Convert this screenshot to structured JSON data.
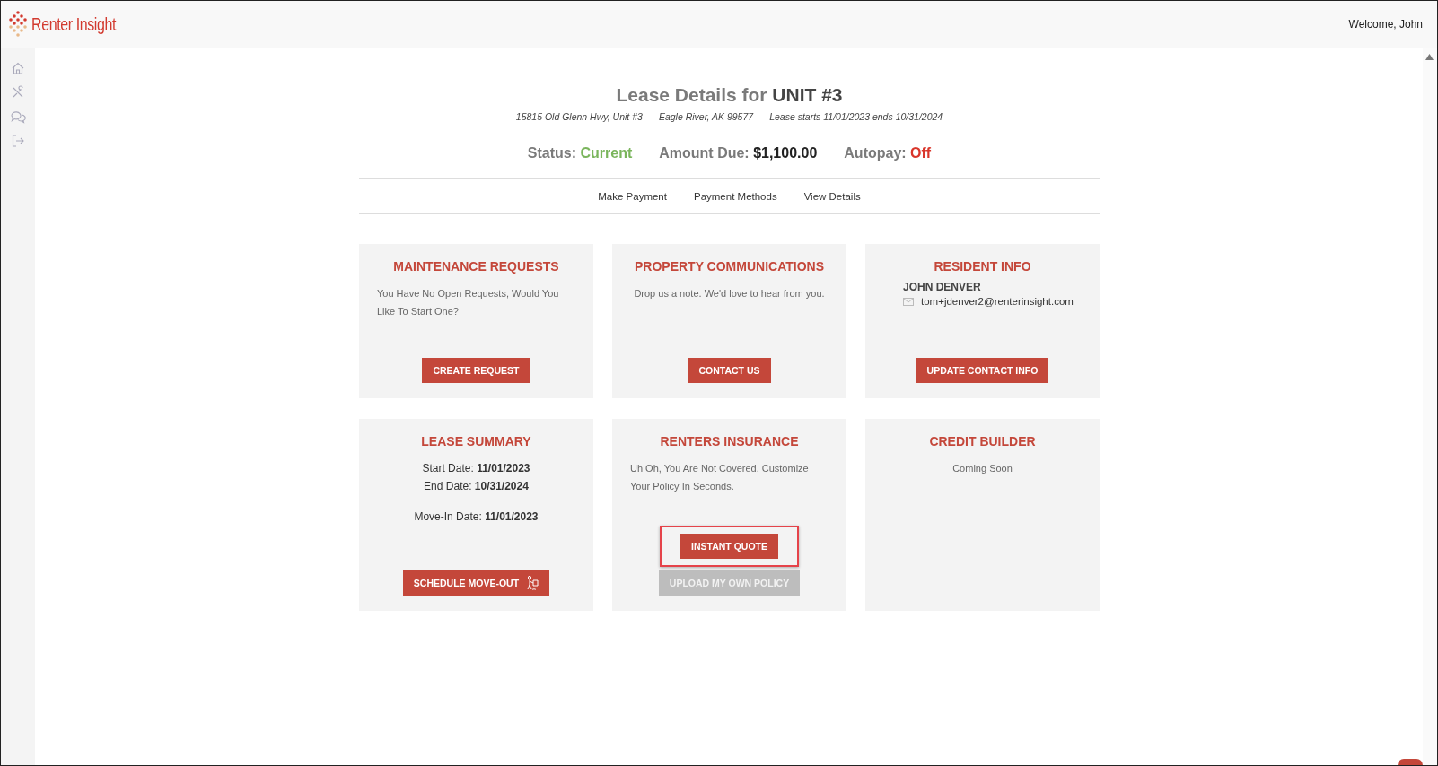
{
  "header": {
    "logo_text": "Renter Insight",
    "welcome": "Welcome, John"
  },
  "lease": {
    "title_prefix": "Lease Details for",
    "unit": "UNIT #3",
    "address": "15815 Old Glenn Hwy, Unit #3",
    "city": "Eagle River, AK 99577",
    "term": "Lease starts 11/01/2023 ends 10/31/2024"
  },
  "summary": [
    {
      "label": "Status:",
      "value": "Current",
      "color": "#7ab55c"
    },
    {
      "label": "Amount Due:",
      "value": "$1,100.00",
      "color": "#222222"
    },
    {
      "label": "Autopay:",
      "value": "Off",
      "color": "#d9362b"
    }
  ],
  "nav": [
    "Make Payment",
    "Payment Methods",
    "View Details"
  ],
  "cards": [
    {
      "kind": "text",
      "title": "MAINTENANCE REQUESTS",
      "text": "You Have No Open Requests, Would You Like To Start One?",
      "buttons": [
        {
          "label": "CREATE REQUEST",
          "disabled": false,
          "highlighted": false
        }
      ]
    },
    {
      "kind": "note",
      "title": "PROPERTY COMMUNICATIONS",
      "text": "Drop us a note. We'd love to hear from you.",
      "buttons": [
        {
          "label": "CONTACT US",
          "disabled": false,
          "highlighted": false
        }
      ]
    },
    {
      "kind": "resident",
      "title": "RESIDENT INFO",
      "name": "JOHN DENVER",
      "email": "tom+jdenver2@renterinsight.com",
      "buttons": [
        {
          "label": "UPDATE CONTACT INFO",
          "disabled": false,
          "highlighted": false
        }
      ]
    },
    {
      "kind": "dates",
      "title": "LEASE SUMMARY",
      "groups": [
        [
          {
            "label": "Start Date:",
            "value": "11/01/2023"
          },
          {
            "label": "End Date:",
            "value": "10/31/2024"
          }
        ],
        [
          {
            "label": "Move-In Date:",
            "value": "11/01/2023"
          }
        ]
      ],
      "buttons": [
        {
          "label": "SCHEDULE MOVE-OUT",
          "disabled": false,
          "highlighted": false
        }
      ]
    },
    {
      "kind": "text",
      "title": "RENTERS INSURANCE",
      "text": "Uh Oh, You Are Not Covered. Customize Your Policy In Seconds.",
      "buttons": [
        {
          "label": "INSTANT QUOTE",
          "disabled": false,
          "highlighted": true
        },
        {
          "label": "UPLOAD MY OWN POLICY",
          "disabled": true,
          "highlighted": false
        }
      ]
    },
    {
      "kind": "note",
      "title": "CREDIT BUILDER",
      "text": "Coming Soon"
    }
  ]
}
